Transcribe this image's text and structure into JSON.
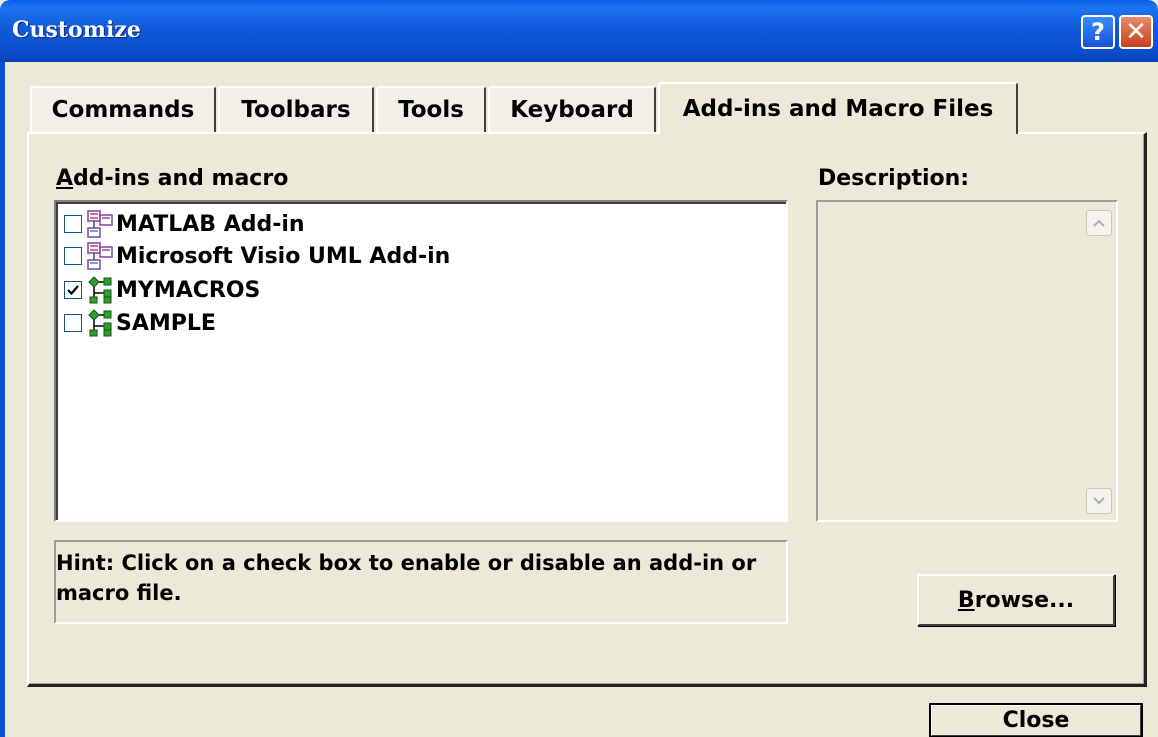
{
  "window": {
    "title": "Customize",
    "help_glyph": "?",
    "close_glyph": "✕"
  },
  "tabs": [
    {
      "label": "Commands",
      "active": false
    },
    {
      "label": "Toolbars",
      "active": false
    },
    {
      "label": "Tools",
      "active": false
    },
    {
      "label": "Keyboard",
      "active": false
    },
    {
      "label": "Add-ins and Macro Files",
      "active": true
    }
  ],
  "addins": {
    "heading_first": "A",
    "heading_rest": "dd-ins and macro",
    "items": [
      {
        "label": "MATLAB Add-in",
        "checked": false,
        "icon": "addin-icon"
      },
      {
        "label": "Microsoft Visio UML Add-in",
        "checked": false,
        "icon": "addin-icon"
      },
      {
        "label": "MYMACROS",
        "checked": true,
        "icon": "macro-file-icon"
      },
      {
        "label": "SAMPLE",
        "checked": false,
        "icon": "macro-file-icon"
      }
    ]
  },
  "description": {
    "heading": "Description:",
    "text": ""
  },
  "hint": "Hint: Click on a check box to enable or disable an add-in or macro file.",
  "buttons": {
    "browse_first": "B",
    "browse_rest": "rowse...",
    "close": "Close"
  },
  "colors": {
    "titlebar": "#0A4FCF",
    "dialog_bg": "#ECE9D8",
    "close_button": "#C8401E",
    "addin_icon": "#C070C0",
    "macro_icon": "#2E9E2E"
  }
}
